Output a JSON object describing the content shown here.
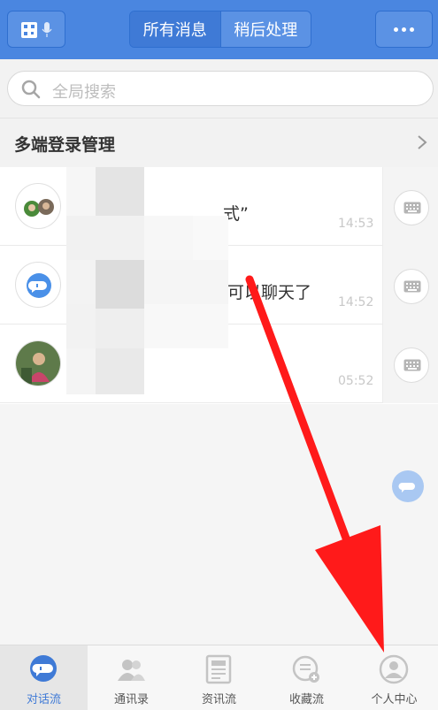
{
  "header": {
    "tabs": [
      {
        "label": "所有消息",
        "active": true
      },
      {
        "label": "稍后处理",
        "active": false
      }
    ],
    "left_icon": "qr-voice-icon",
    "right_icon": "more-dots-icon"
  },
  "search": {
    "placeholder": "全局搜索"
  },
  "section": {
    "title": "多端登录管理"
  },
  "conversations": [
    {
      "snippet": "式”",
      "time": "14:53",
      "avatar": "group-avatar"
    },
    {
      "snippet": "可以聊天了",
      "time": "14:52",
      "avatar": "bot-avatar"
    },
    {
      "snippet": "",
      "time": "05:52",
      "avatar": "photo-avatar"
    }
  ],
  "bottom_nav": [
    {
      "label": "对话流",
      "icon": "chat-icon",
      "active": true
    },
    {
      "label": "通讯录",
      "icon": "contacts-icon",
      "active": false
    },
    {
      "label": "资讯流",
      "icon": "news-icon",
      "active": false
    },
    {
      "label": "收藏流",
      "icon": "favorites-icon",
      "active": false
    },
    {
      "label": "个人中心",
      "icon": "profile-icon",
      "active": false
    }
  ],
  "colors": {
    "header": "#4a86e0",
    "accent": "#3f7ad6",
    "arrow": "#ff1a1a"
  }
}
